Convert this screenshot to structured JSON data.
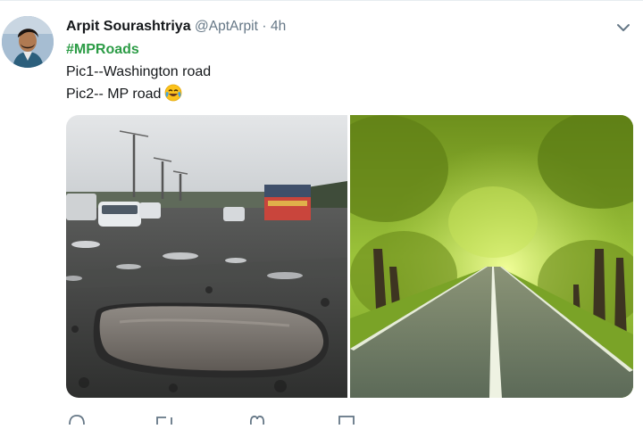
{
  "tweet": {
    "author_name": "Arpit Sourashtriya",
    "handle": "@AptArpit",
    "separator": "·",
    "time": "4h",
    "hashtag": "#MPRoads",
    "line1": "Pic1--Washington road",
    "line2": "Pic2-- MP road",
    "emoji_icon": "face-with-tears-of-joy-icon",
    "media": [
      {
        "description_icon": "pothole-road-photo"
      },
      {
        "description_icon": "tree-lined-road-photo"
      }
    ]
  },
  "colors": {
    "hashtag": "#2c9c46",
    "name": "#14171a",
    "muted": "#657786"
  },
  "actions": [
    "reply-icon",
    "retweet-icon",
    "like-icon",
    "message-icon"
  ]
}
